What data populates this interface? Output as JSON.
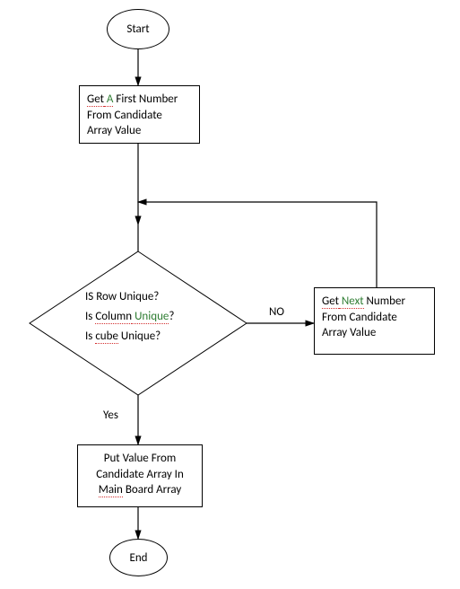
{
  "chart_data": {
    "type": "flowchart",
    "nodes": [
      {
        "id": "start",
        "shape": "terminator",
        "label": "Start"
      },
      {
        "id": "getfirst",
        "shape": "process",
        "label": "Get A First Number From Candidate Array Value"
      },
      {
        "id": "check",
        "shape": "decision",
        "label": "IS Row Unique?\nIs Column Unique?\nIs cube Unique?"
      },
      {
        "id": "getnext",
        "shape": "process",
        "label": "Get Next Number From Candidate Array Value"
      },
      {
        "id": "putvalue",
        "shape": "process",
        "label": "Put Value From Candidate Array In Main Board Array"
      },
      {
        "id": "end",
        "shape": "terminator",
        "label": "End"
      }
    ],
    "edges": [
      {
        "from": "start",
        "to": "getfirst"
      },
      {
        "from": "getfirst",
        "to": "check"
      },
      {
        "from": "check",
        "to": "getnext",
        "label": "NO"
      },
      {
        "from": "getnext",
        "to": "check",
        "route": "up-left"
      },
      {
        "from": "check",
        "to": "putvalue",
        "label": "Yes"
      },
      {
        "from": "putvalue",
        "to": "end"
      }
    ]
  },
  "labels": {
    "start": "Start",
    "end": "End",
    "getfirst_l1_a": "Get",
    "getfirst_l1_b": " A",
    "getfirst_l1_c": " First Number",
    "getfirst_l2": "From Candidate",
    "getfirst_l3": "Array Value",
    "decision_q1": "IS Row Unique?",
    "decision_q2_a": "Is ",
    "decision_q2_b": "Column",
    "decision_q2_b2": " Unique",
    "decision_q2_c": "?",
    "decision_q3_a": "Is ",
    "decision_q3_b": "cube",
    "decision_q3_c": " Unique?",
    "getnext_l1_a": "Get",
    "getnext_l1_b": " Next",
    "getnext_l1_c": " Number",
    "getnext_l2": "From Candidate",
    "getnext_l3": "Array Value",
    "putvalue_l1": "Put Value From",
    "putvalue_l2": "Candidate Array In",
    "putvalue_l3_a": "Main",
    "putvalue_l3_b": " Board Array",
    "edge_no": "NO",
    "edge_yes": "Yes"
  }
}
